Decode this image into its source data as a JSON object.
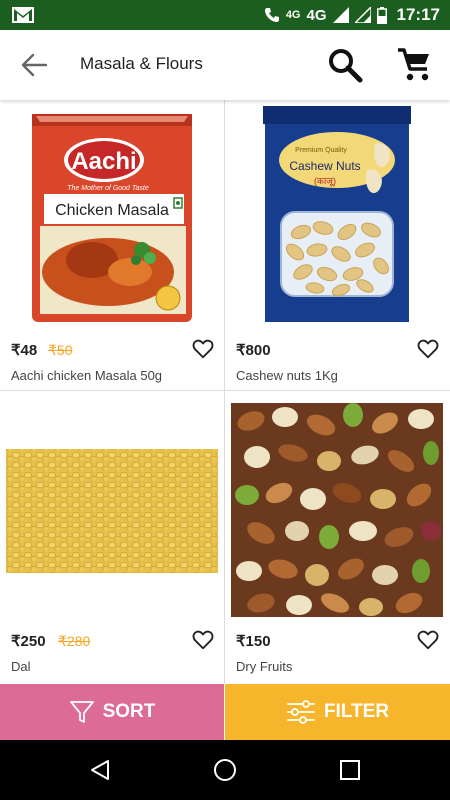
{
  "status_bar": {
    "network_label": "4G",
    "network_label_2": "4G",
    "time": "17:17"
  },
  "app_bar": {
    "title": "Masala & Flours"
  },
  "products": [
    {
      "price": "₹48",
      "mrp": "₹50",
      "name": "Aachi chicken Masala 50g",
      "package_brand": "Aachi",
      "package_tagline": "The Mother of Good Taste",
      "package_title": "Chicken Masala"
    },
    {
      "price": "₹800",
      "mrp": "",
      "name": "Cashew nuts 1Kg",
      "package_title": "Cashew Nuts",
      "package_subtitle": "(काजू)",
      "package_small": "Premium Quality"
    },
    {
      "price": "₹250",
      "mrp": "₹280",
      "name": "Dal"
    },
    {
      "price": "₹150",
      "mrp": "",
      "name": "Dry Fruits"
    }
  ],
  "actions": {
    "sort_label": "SORT",
    "filter_label": "FILTER"
  },
  "colors": {
    "status_bar": "#1b5e20",
    "sort": "#dc6b96",
    "filter": "#f6b52a",
    "mrp": "#f5a623"
  },
  "icons": [
    "gmail-icon",
    "call-icon",
    "signal-icon",
    "battery-icon",
    "back-arrow-icon",
    "search-icon",
    "cart-icon",
    "heart-icon",
    "filter-funnel-icon",
    "sliders-icon",
    "nav-back-icon",
    "nav-home-icon",
    "nav-recents-icon"
  ]
}
